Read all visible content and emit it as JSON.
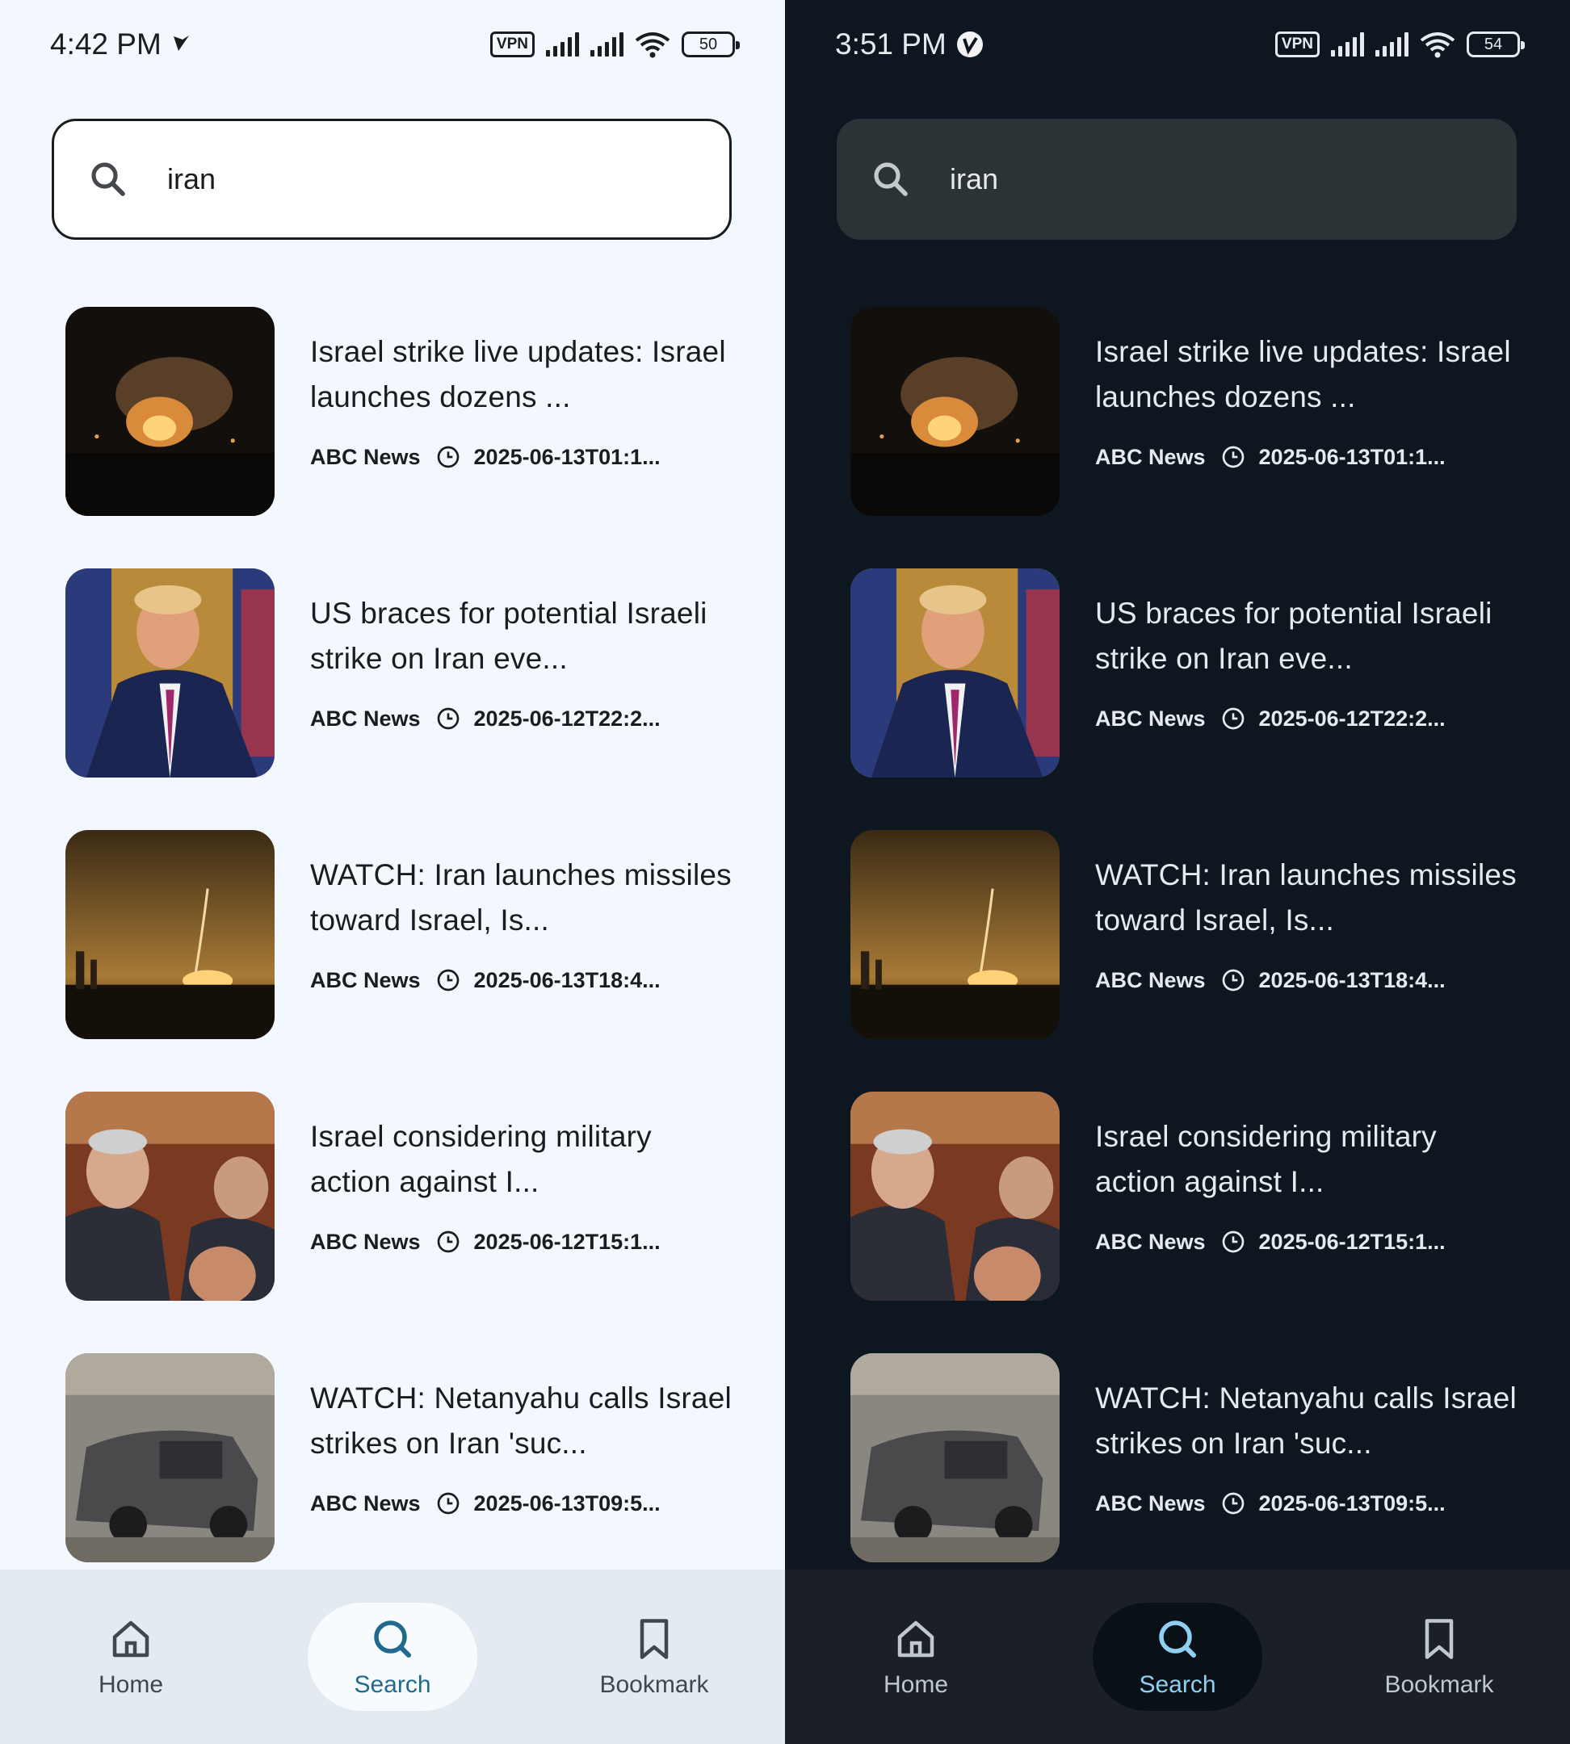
{
  "light": {
    "status": {
      "time": "4:42 PM",
      "vpn": "VPN",
      "battery": "50"
    },
    "search": {
      "query": "iran"
    },
    "articles": [
      {
        "title": "Israel strike live updates: Israel launches dozens ...",
        "source": "ABC News",
        "date": "2025-06-13T01:1..."
      },
      {
        "title": "US braces for potential Israeli strike on Iran eve...",
        "source": "ABC News",
        "date": "2025-06-12T22:2..."
      },
      {
        "title": "WATCH: Iran launches missiles toward Israel, Is...",
        "source": "ABC News",
        "date": "2025-06-13T18:4..."
      },
      {
        "title": "Israel considering military action against I...",
        "source": "ABC News",
        "date": "2025-06-12T15:1..."
      },
      {
        "title": "WATCH: Netanyahu calls Israel strikes on Iran 'suc...",
        "source": "ABC News",
        "date": "2025-06-13T09:5..."
      }
    ],
    "nav": {
      "home": "Home",
      "search": "Search",
      "bookmark": "Bookmark"
    }
  },
  "dark": {
    "status": {
      "time": "3:51 PM",
      "vpn": "VPN",
      "battery": "54"
    },
    "search": {
      "query": "iran"
    },
    "articles": [
      {
        "title": "Israel strike live updates: Israel launches dozens ...",
        "source": "ABC News",
        "date": "2025-06-13T01:1..."
      },
      {
        "title": "US braces for potential Israeli strike on Iran eve...",
        "source": "ABC News",
        "date": "2025-06-12T22:2..."
      },
      {
        "title": "WATCH: Iran launches missiles toward Israel, Is...",
        "source": "ABC News",
        "date": "2025-06-13T18:4..."
      },
      {
        "title": "Israel considering military action against I...",
        "source": "ABC News",
        "date": "2025-06-12T15:1..."
      },
      {
        "title": "WATCH: Netanyahu calls Israel strikes on Iran 'suc...",
        "source": "ABC News",
        "date": "2025-06-13T09:5..."
      }
    ],
    "nav": {
      "home": "Home",
      "search": "Search",
      "bookmark": "Bookmark"
    }
  },
  "colors": {
    "accent_light": "#216a8d",
    "accent_dark": "#8ecff2",
    "bg_light": "#f2f8fd",
    "bg_dark": "#0e1720"
  }
}
